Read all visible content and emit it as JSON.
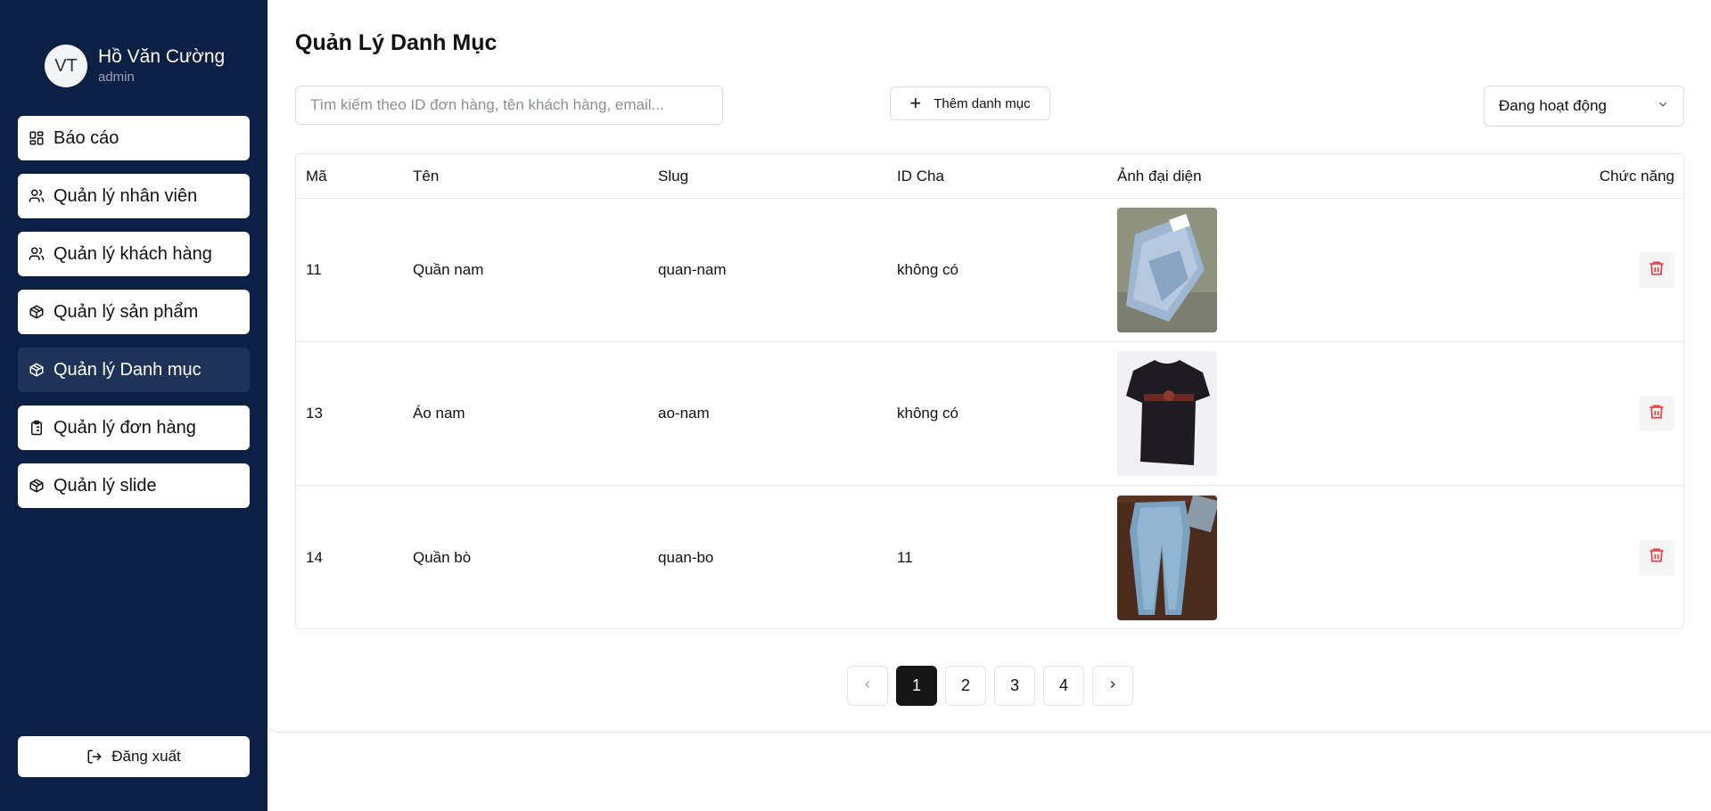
{
  "user": {
    "initials": "VT",
    "name": "Hồ Văn Cường",
    "role": "admin"
  },
  "sidebar": {
    "items": [
      {
        "label": "Báo cáo",
        "icon": "dashboard-icon",
        "active": false
      },
      {
        "label": "Quản lý nhân viên",
        "icon": "users-icon",
        "active": false
      },
      {
        "label": "Quản lý khách hàng",
        "icon": "users-icon",
        "active": false
      },
      {
        "label": "Quản lý sản phẩm",
        "icon": "package-icon",
        "active": false
      },
      {
        "label": "Quản lý Danh mục",
        "icon": "package-icon",
        "active": true
      },
      {
        "label": "Quản lý đơn hàng",
        "icon": "clipboard-list-icon",
        "active": false
      },
      {
        "label": "Quản lý slide",
        "icon": "package-icon",
        "active": false
      }
    ],
    "logout_label": "Đăng xuất"
  },
  "page": {
    "title": "Quản Lý Danh Mục",
    "search_placeholder": "Tìm kiếm theo ID đơn hàng, tên khách hàng, email...",
    "add_button_label": "Thêm danh mục",
    "status_filter": "Đang hoạt động"
  },
  "table": {
    "headers": [
      "Mã",
      "Tên",
      "Slug",
      "ID Cha",
      "Ảnh đại diện",
      "Chức năng"
    ],
    "rows": [
      {
        "id": "11",
        "name": "Quần nam",
        "slug": "quan-nam",
        "parent": "không có",
        "image": "jeans-folded"
      },
      {
        "id": "13",
        "name": "Áo nam",
        "slug": "ao-nam",
        "parent": "không có",
        "image": "black-tshirt"
      },
      {
        "id": "14",
        "name": "Quần bò",
        "slug": "quan-bo",
        "parent": "11",
        "image": "jeans-flat"
      }
    ]
  },
  "pagination": {
    "pages": [
      "1",
      "2",
      "3",
      "4"
    ],
    "current": "1"
  },
  "colors": {
    "sidebar_bg": "#0c1f45",
    "active_item_bg": "#1f3358",
    "delete_icon": "#e53e3e",
    "active_page_bg": "#161616"
  }
}
